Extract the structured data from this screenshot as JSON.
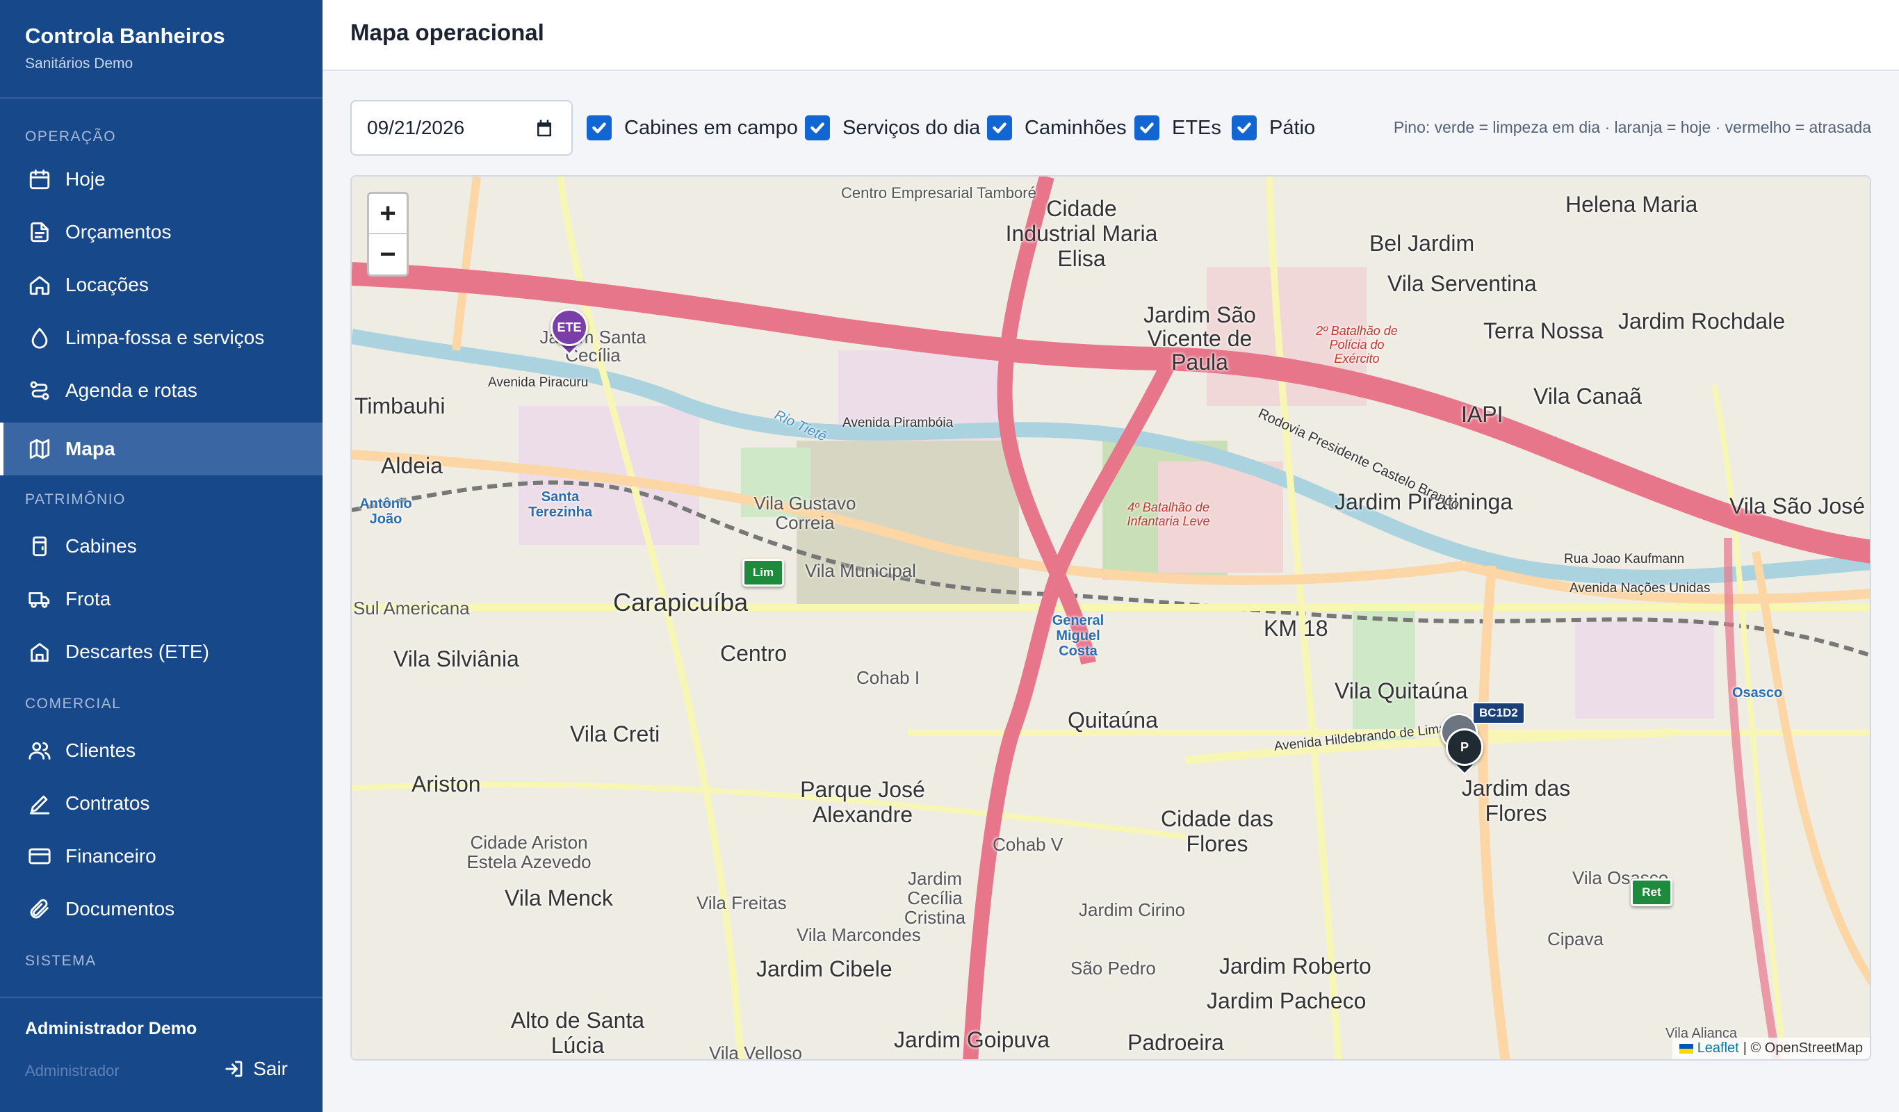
{
  "app": {
    "title": "Controla Banheiros",
    "subtitle": "Sanitários Demo"
  },
  "sidebar": {
    "sections": [
      {
        "label": "OPERAÇÃO"
      },
      {
        "label": "PATRIMÔNIO"
      },
      {
        "label": "COMERCIAL"
      },
      {
        "label": "SISTEMA"
      }
    ],
    "items": [
      {
        "label": "Hoje",
        "icon": "calendar-icon"
      },
      {
        "label": "Orçamentos",
        "icon": "document-icon"
      },
      {
        "label": "Locações",
        "icon": "home-icon"
      },
      {
        "label": "Limpa-fossa e serviços",
        "icon": "droplet-icon"
      },
      {
        "label": "Agenda e rotas",
        "icon": "route-icon"
      },
      {
        "label": "Mapa",
        "icon": "map-icon",
        "active": true
      },
      {
        "label": "Cabines",
        "icon": "cabin-icon"
      },
      {
        "label": "Frota",
        "icon": "truck-icon"
      },
      {
        "label": "Descartes (ETE)",
        "icon": "building-icon"
      },
      {
        "label": "Clientes",
        "icon": "users-icon"
      },
      {
        "label": "Contratos",
        "icon": "pen-icon"
      },
      {
        "label": "Financeiro",
        "icon": "card-icon"
      },
      {
        "label": "Documentos",
        "icon": "paperclip-icon"
      }
    ],
    "user": {
      "name": "Administrador Demo",
      "role": "Administrador",
      "logout_label": "Sair"
    }
  },
  "header": {
    "title": "Mapa operacional"
  },
  "filters": {
    "date_value": "09/21/2026",
    "checkboxes": [
      {
        "label": "Cabines em campo",
        "checked": true
      },
      {
        "label": "Serviços do dia",
        "checked": true
      },
      {
        "label": "Caminhões",
        "checked": true
      },
      {
        "label": "ETEs",
        "checked": true
      },
      {
        "label": "Pátio",
        "checked": true
      }
    ],
    "legend_note": "Pino: verde = limpeza em dia · laranja = hoje · vermelho = atrasada"
  },
  "map": {
    "zoom_in": "+",
    "zoom_out": "−",
    "attribution_link": "Leaflet",
    "attribution_text": "| © OpenStreetMap",
    "markers": {
      "ete": "ETE",
      "lim": "Lim",
      "ret": "Ret",
      "truck": "BC1D2",
      "yard": "P"
    },
    "labels": [
      "Centro Empresarial Tamboré",
      "Cidade Industrial Maria Elisa",
      "Helena Maria",
      "Bel Jardim",
      "Vila Serventina",
      "Jardim São Vicente de Paula",
      "Terra Nossa",
      "Jardim Rochdale",
      "Jardim Santa Cecília",
      "Timbauhi",
      "Aldeia",
      "Antônio João",
      "Santa Terezinha",
      "Vila Gustavo Correia",
      "Vila Municipal",
      "Carapicuíba",
      "Sul Americana",
      "Vila Silviânia",
      "Centro",
      "Cohab I",
      "Vila Creti",
      "Quitaúna",
      "KM 18",
      "General Miguel Costa",
      "Vila Quitaúna",
      "Jardim Piratininga",
      "Vila Canaã",
      "IAPI",
      "Vila São José",
      "Osasco",
      "Jardim das Flores",
      "Ariston",
      "Cidade Ariston Estela Azevedo",
      "Parque José Alexandre",
      "Cidade das Flores",
      "Vila Menck",
      "Vila Freitas",
      "Jardim Cecília Cristina",
      "Cohab V",
      "Jardim Cirino",
      "Vila Osasco",
      "Vila Marcondes",
      "Jardim Cibele",
      "São Pedro",
      "Jardim Roberto",
      "Jardim Pacheco",
      "Cipava",
      "Alto de Santa Lúcia",
      "Jardim Goipuva",
      "Padroeira",
      "Vila Alianca",
      "Vila Velloso",
      "2º Batalhão de Polícia do Exército",
      "4º Batalhão de Infantaria Leve",
      "Rodovia Presidente Castelo Branco",
      "Avenida Piracuru",
      "Avenida Pirambóia",
      "Rio Tietê",
      "Rua Joao Kaufmann",
      "Avenida Nações Unidas",
      "Avenida Hildebrando de Lima"
    ]
  },
  "colors": {
    "sidebar_bg": "#17488a",
    "active_item": "#3a66a3",
    "checkbox": "#1166d4",
    "ete_marker": "#7a3ea8",
    "lim_marker": "#1e8a3c",
    "truck_tag": "#1b3f77",
    "yard_marker": "#1f2a33",
    "highway": "#e8768b",
    "river": "#aad3df"
  }
}
